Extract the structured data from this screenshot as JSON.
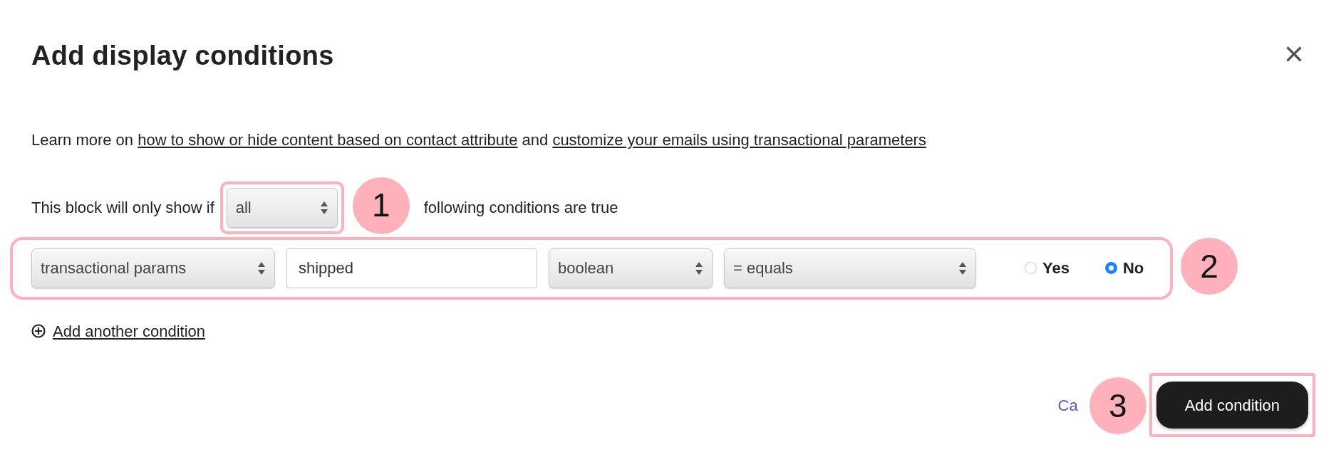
{
  "dialog": {
    "title": "Add display conditions",
    "close": "×"
  },
  "intro": {
    "prefix": "Learn more on",
    "link_1": "how to show or hide content based on contact attribute",
    "middle": "and",
    "link_2": "customize your emails using transactional parameters"
  },
  "rule": {
    "prefix": "This block will only show if",
    "match": "all",
    "suffix": "following conditions are true"
  },
  "condition": {
    "source": "transactional params",
    "field_value": "shipped",
    "type": "boolean",
    "operator": "= equals",
    "options": [
      {
        "label": "Yes",
        "selected": false
      },
      {
        "label": "No",
        "selected": true
      }
    ]
  },
  "add_link": "Add another condition",
  "footer": {
    "cancel": "Ca",
    "submit": "Add condition"
  },
  "annotations": [
    {
      "label": "1"
    },
    {
      "label": "2"
    },
    {
      "label": "3"
    }
  ]
}
